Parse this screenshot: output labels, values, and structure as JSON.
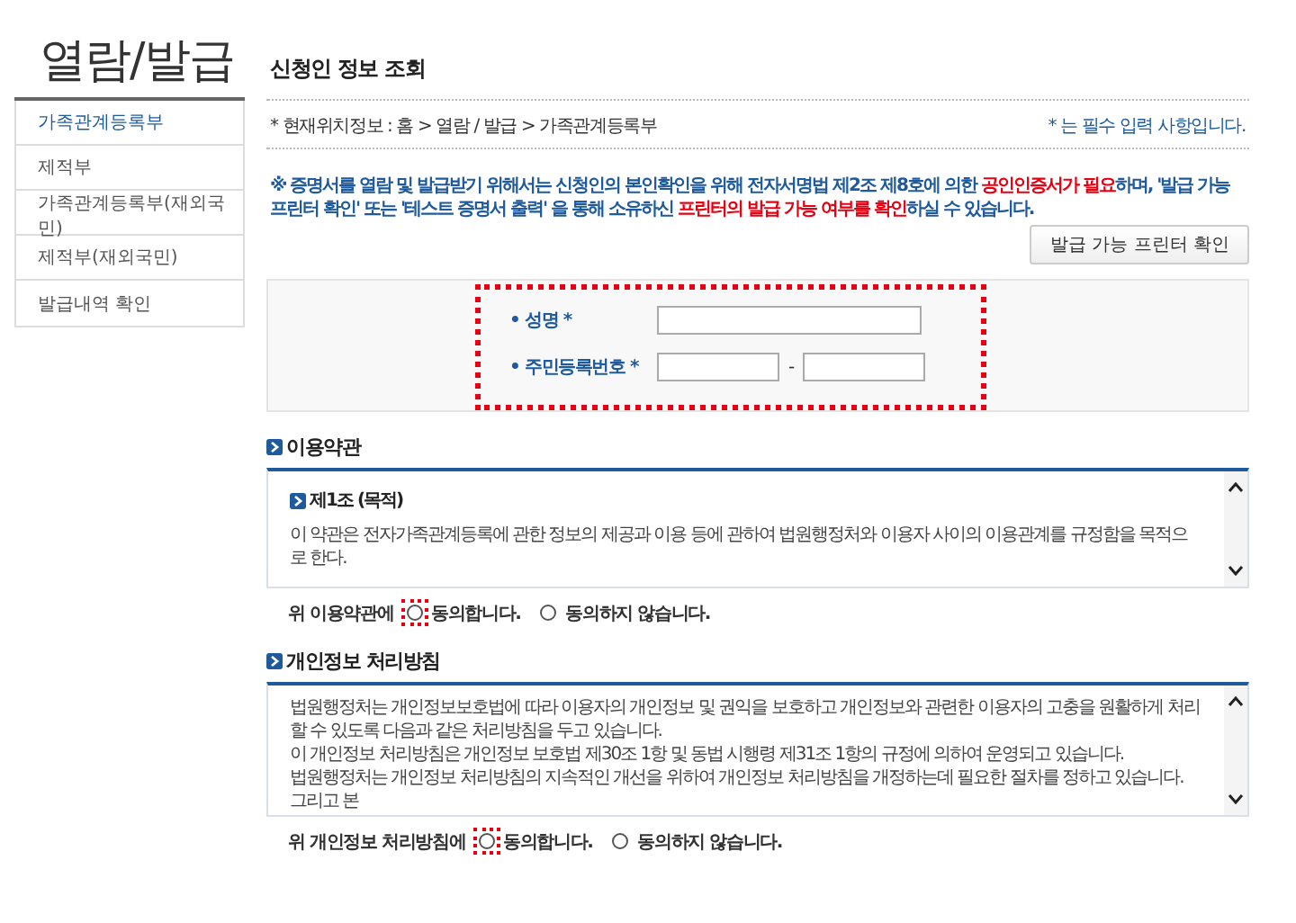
{
  "sidebar": {
    "title": "열람/발급",
    "items": [
      {
        "label": "가족관계등록부",
        "selected": true
      },
      {
        "label": "제적부",
        "selected": false
      },
      {
        "label": "가족관계등록부(재외국민)",
        "selected": false
      },
      {
        "label": "제적부(재외국민)",
        "selected": false
      },
      {
        "label": "발급내역 확인",
        "selected": false
      }
    ]
  },
  "page_title": "신청인 정보 조회",
  "breadcrumb": "* 현재위치정보 : 홈 > 열람 / 발급 > 가족관계등록부",
  "required_note": "* 는 필수 입력 사항입니다.",
  "notice": [
    {
      "text": "※ 증명서를 열람 및 발급받기 위해서는 신청인의 본인확인을 위해 전자서명법 제2조 제8호에 의한 ",
      "emphasis": false
    },
    {
      "text": "공인인증서가 필요",
      "emphasis": true
    },
    {
      "text": "하며, '발급 가능 프린터 확인' 또는 '테스트 증명서 출력' 을 통해 소유하신 ",
      "emphasis": false
    },
    {
      "text": "프린터의 발급 가능 여부를 확인",
      "emphasis": true
    },
    {
      "text": "하실 수 있습니다.",
      "emphasis": false
    }
  ],
  "printer_button": "발급 가능 프린터 확인",
  "form": {
    "highlighted": true,
    "fields": [
      {
        "label": "• 성명 *",
        "kind": "single"
      },
      {
        "label": "• 주민등록번호 *",
        "kind": "split",
        "separator": "-"
      }
    ]
  },
  "sections": [
    {
      "title": "이용약관",
      "heading": "제1조 (목적)",
      "lines": [
        "이 약관은 전자가족관계등록에 관한 정보의 제공과 이용 등에 관하여 법원행정처와 이용자 사이의 이용관계를 규정함을 목적으로 한다."
      ],
      "consent": {
        "prompt": "위 이용약관에",
        "options": [
          {
            "label": "동의합니다.",
            "selected": false,
            "highlighted": true
          },
          {
            "label": "동의하지 않습니다.",
            "selected": false,
            "highlighted": false
          }
        ]
      }
    },
    {
      "title": "개인정보 처리방침",
      "lines": [
        "법원행정처는 개인정보보호법에 따라 이용자의 개인정보 및 권익을 보호하고 개인정보와 관련한 이용자의 고충을 원활하게 처리할 수 있도록 다음과 같은 처리방침을 두고 있습니다.",
        "이 개인정보 처리방침은 개인정보 보호법 제30조 1항 및 동법 시행령 제31조 1항의 규정에 의하여 운영되고 있습니다.",
        "법원행정처는 개인정보 처리방침의 지속적인 개선을 위하여 개인정보 처리방침을 개정하는데 필요한 절차를 정하고 있습니다. 그리고 본"
      ],
      "consent": {
        "prompt": "위 개인정보 처리방침에",
        "options": [
          {
            "label": "동의합니다.",
            "selected": false,
            "highlighted": true
          },
          {
            "label": "동의하지 않습니다.",
            "selected": false,
            "highlighted": false
          }
        ]
      }
    }
  ]
}
